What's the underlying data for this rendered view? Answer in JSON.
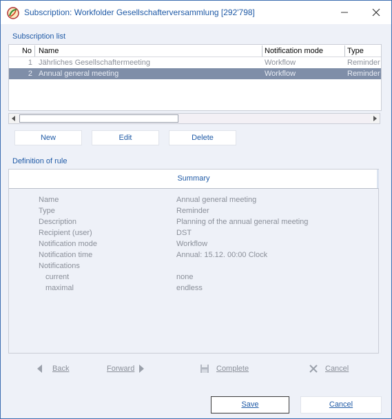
{
  "window": {
    "title": "Subscription: Workfolder Gesellschafterversammlung [292'798]",
    "minimize_glyph": "—",
    "close_glyph": "✕",
    "icon": "app-logo-icon"
  },
  "subscription_list": {
    "label": "Subscription list",
    "columns": [
      "No",
      "Name",
      "Notification mode",
      "Type"
    ],
    "rows": [
      {
        "no": "1",
        "name": "Jährliches Gesellschaftermeeting",
        "mode": "Workflow",
        "type": "Reminder"
      },
      {
        "no": "2",
        "name": "Annual general meeting",
        "mode": "Workflow",
        "type": "Reminder",
        "selected": true
      }
    ],
    "buttons": {
      "new": "New",
      "edit": "Edit",
      "delete": "Delete"
    }
  },
  "definition": {
    "label": "Definition of rule",
    "summary_title": "Summary",
    "fields": [
      {
        "key": "Name",
        "value": "Annual general meeting"
      },
      {
        "key": "Type",
        "value": "Reminder"
      },
      {
        "key": "Description",
        "value": "Planning of the annual general meeting"
      },
      {
        "key": "Recipient (user)",
        "value": "DST"
      },
      {
        "key": "Notification mode",
        "value": "Workflow"
      },
      {
        "key": "Notification time",
        "value": "Annual: 15.12. 00:00 Clock"
      },
      {
        "key": "Notifications",
        "value": ""
      },
      {
        "key": "current",
        "value": "none",
        "indent": true
      },
      {
        "key": "maximal",
        "value": "endless",
        "indent": true
      }
    ]
  },
  "wizard_nav": {
    "back": "Back",
    "forward": "Forward",
    "complete": "Complete",
    "cancel": "Cancel"
  },
  "dialog_buttons": {
    "save": "Save",
    "cancel": "Cancel"
  },
  "colors": {
    "accent": "#1f5aa6",
    "selection": "#7f8ea8",
    "disabled_text": "#8a8f99",
    "background": "#eef1f8"
  }
}
